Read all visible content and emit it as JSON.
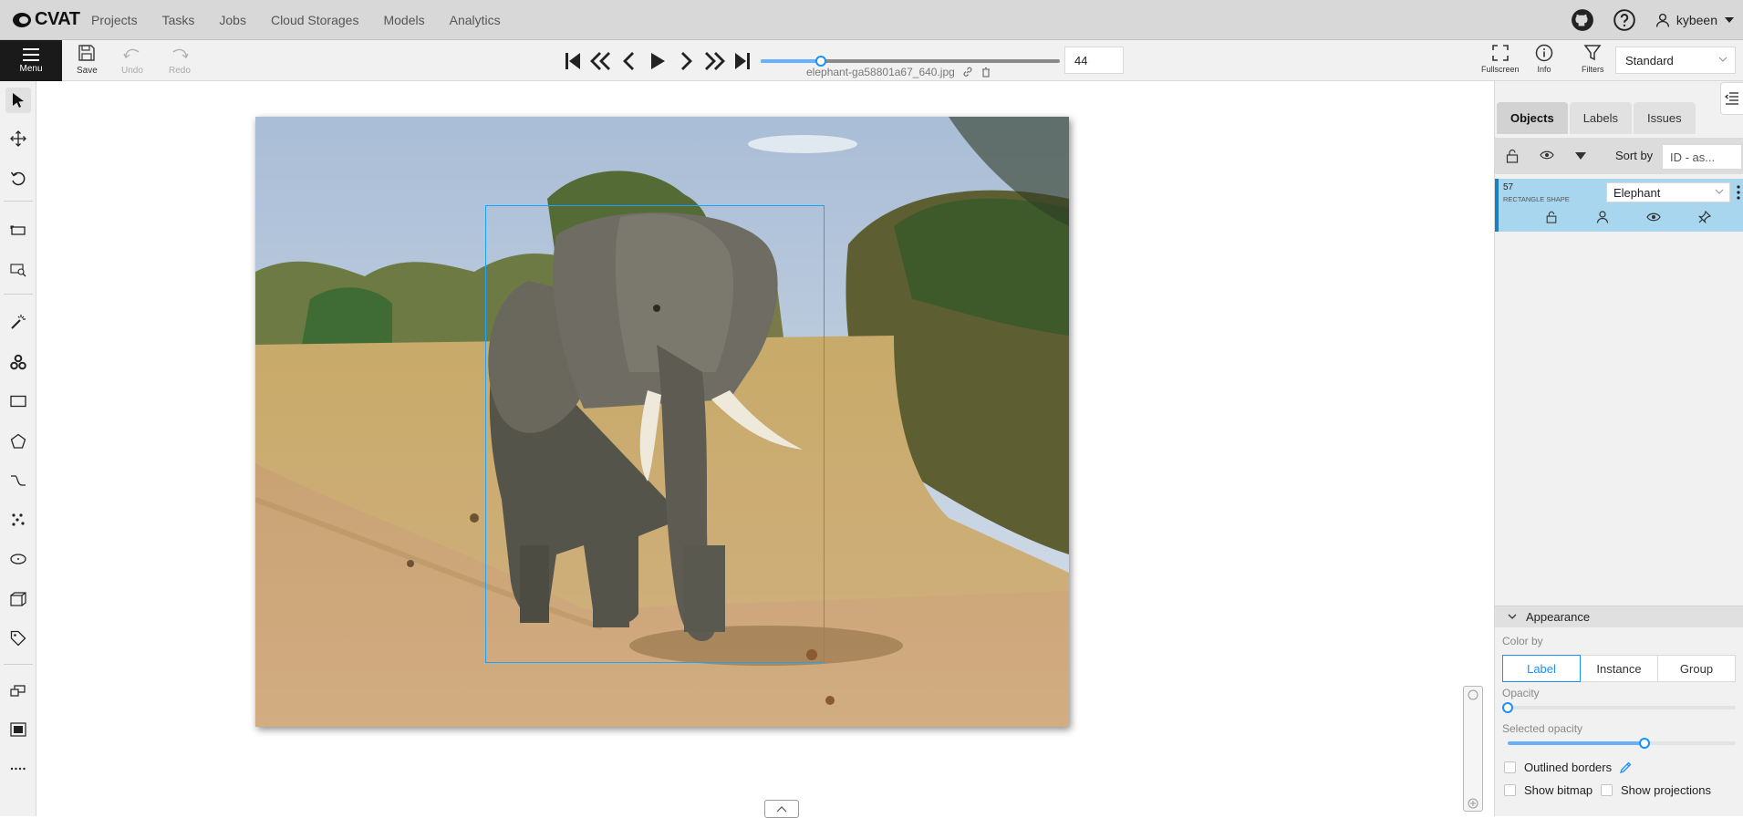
{
  "app": {
    "logo_text": "CVAT"
  },
  "nav": {
    "links": [
      "Projects",
      "Tasks",
      "Jobs",
      "Cloud Storages",
      "Models",
      "Analytics"
    ],
    "user": "kybeen"
  },
  "toolbar": {
    "menu_label": "Menu",
    "save_label": "Save",
    "undo_label": "Undo",
    "redo_label": "Redo",
    "filename": "elephant-ga58801a67_640.jpg",
    "frame_number": "44",
    "frame_progress": 0.2,
    "fullscreen_label": "Fullscreen",
    "info_label": "Info",
    "filters_label": "Filters",
    "workspace": "Standard"
  },
  "sidebar": {
    "tabs": [
      "Objects",
      "Labels",
      "Issues"
    ],
    "active_tab": "Objects",
    "sort_label": "Sort by",
    "sort_value": "ID - as..."
  },
  "object": {
    "id": "57",
    "type": "RECTANGLE SHAPE",
    "label": "Elephant",
    "color": "#a7d6ee"
  },
  "appearance": {
    "title": "Appearance",
    "color_by_label": "Color by",
    "color_by_options": [
      "Label",
      "Instance",
      "Group"
    ],
    "color_by_selected": "Label",
    "opacity_label": "Opacity",
    "opacity_value": 0,
    "selected_opacity_label": "Selected opacity",
    "selected_opacity_value": 0.6,
    "outlined_borders_label": "Outlined borders",
    "show_bitmap_label": "Show bitmap",
    "show_projections_label": "Show projections"
  },
  "colors": {
    "accent": "#1890ff",
    "bbox": "#1aa3ff",
    "menu_bg": "#1a1a1a"
  }
}
